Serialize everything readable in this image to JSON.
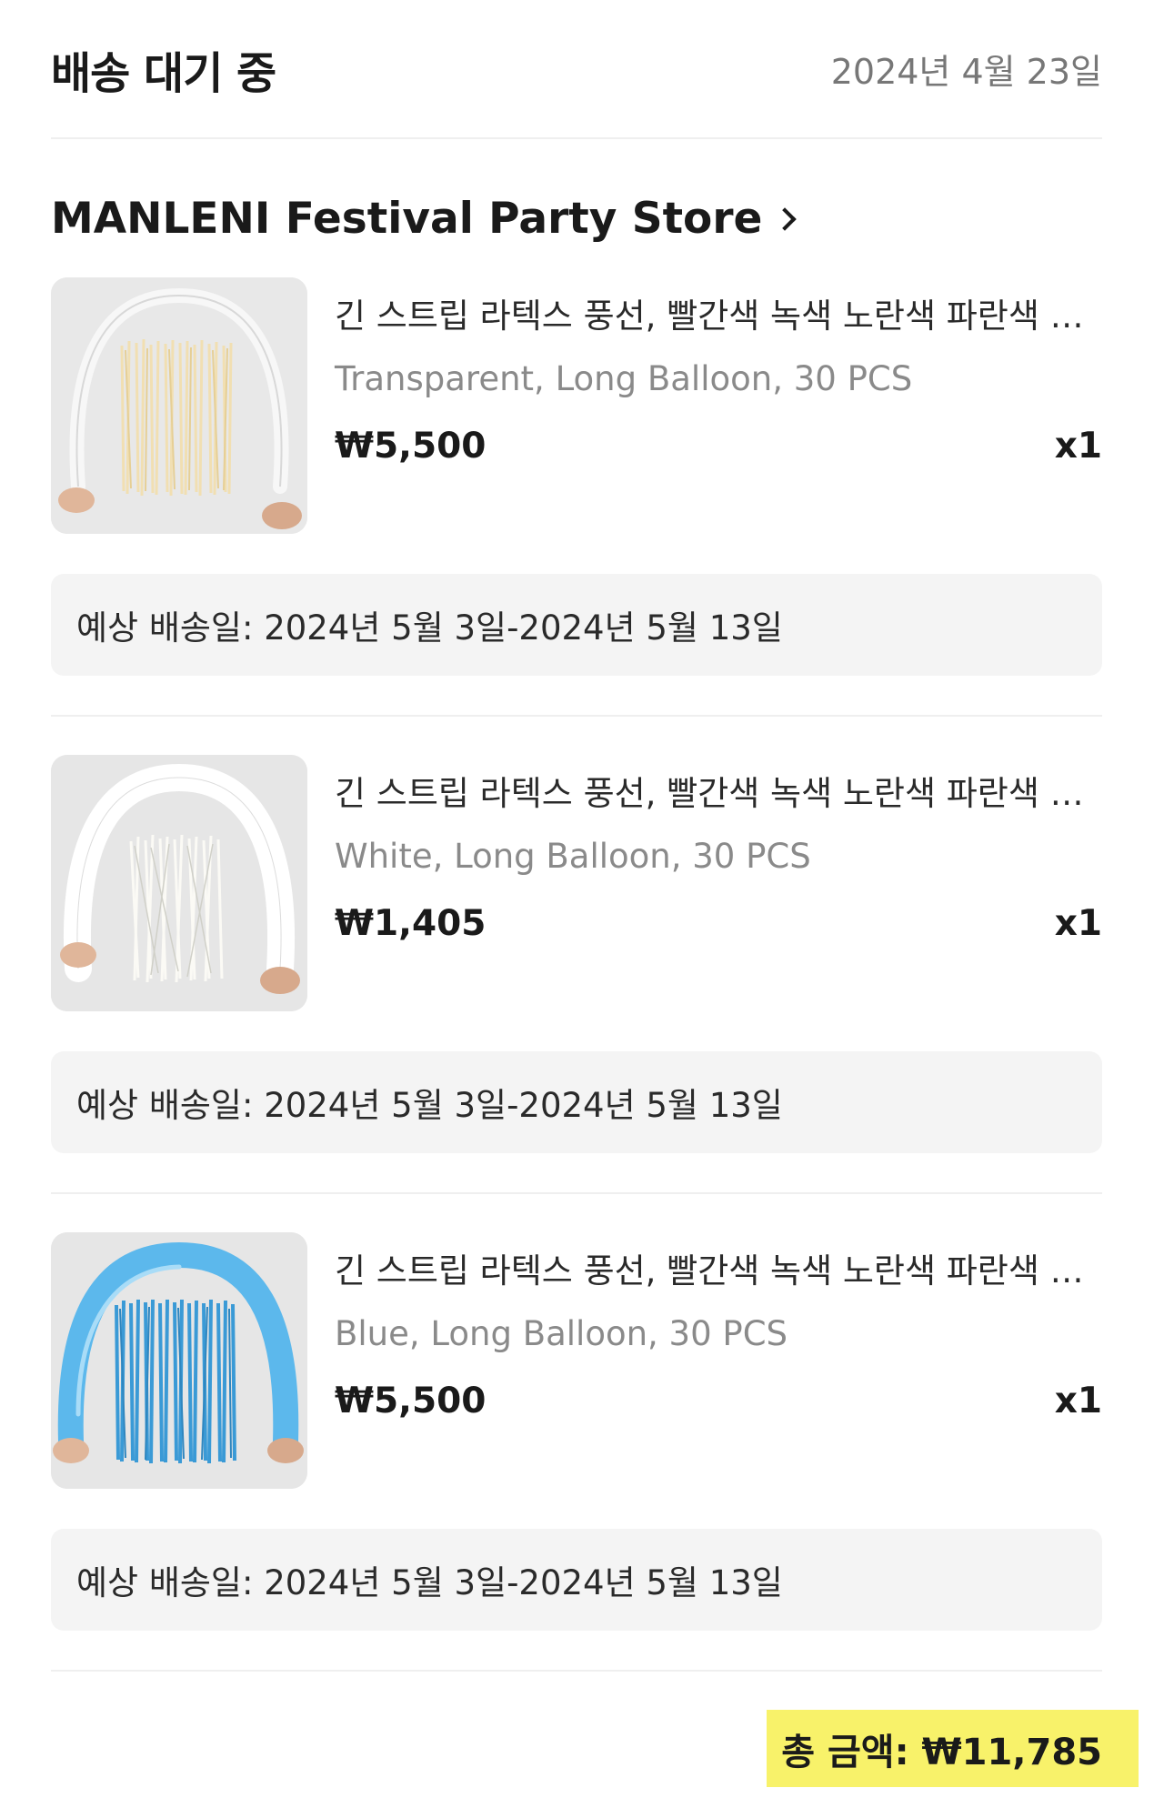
{
  "header": {
    "status": "배송 대기 중",
    "order_date": "2024년 4월 23일"
  },
  "store": {
    "name": "MANLENI Festival Party Store"
  },
  "items": [
    {
      "title": "긴 스트립 라텍스 풍선, 빨간색 녹색 노란색 파란색 흰색 검정색",
      "variant": "Transparent, Long Balloon, 30 PCS",
      "price": "₩5,500",
      "quantity": "x1",
      "delivery": "예상 배송일: 2024년 5월 3일-2024년 5월 13일",
      "thumb_colors": {
        "bg": "#e8e8e8",
        "balloon": "#f2f2f2",
        "strips": "#f1dfb2",
        "strip_dark": "#e6cf95"
      }
    },
    {
      "title": "긴 스트립 라텍스 풍선, 빨간색 녹색 노란색 파란색 흰색 검정색",
      "variant": "White, Long Balloon, 30 PCS",
      "price": "₩1,405",
      "quantity": "x1",
      "delivery": "예상 배송일: 2024년 5월 3일-2024년 5월 13일",
      "thumb_colors": {
        "bg": "#e6e6e6",
        "balloon": "#ffffff",
        "strips": "#fbfaf5",
        "strip_dark": "#d9d9d2"
      }
    },
    {
      "title": "긴 스트립 라텍스 풍선, 빨간색 녹색 노란색 파란색 흰색 검정색",
      "variant": "Blue, Long Balloon, 30 PCS",
      "price": "₩5,500",
      "quantity": "x1",
      "delivery": "예상 배송일: 2024년 5월 3일-2024년 5월 13일",
      "thumb_colors": {
        "bg": "#e6e6e6",
        "balloon": "#5cb8ec",
        "strips": "#3a9ad6",
        "strip_dark": "#2f86bf"
      }
    }
  ],
  "total": {
    "label": "총 금액: ₩11,785",
    "highlight_color": "#f8f26a"
  }
}
